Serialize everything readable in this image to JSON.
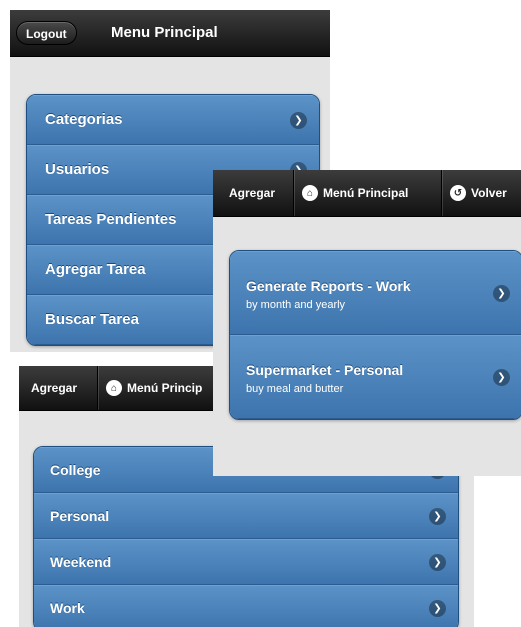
{
  "screen1": {
    "logout_label": "Logout",
    "title": "Menu Principal",
    "items": [
      {
        "label": "Categorias"
      },
      {
        "label": "Usuarios"
      },
      {
        "label": "Tareas Pendientes"
      },
      {
        "label": "Agregar Tarea"
      },
      {
        "label": "Buscar Tarea"
      }
    ]
  },
  "screen2": {
    "agregar_label": "Agregar",
    "menu_label": "Menú Principal",
    "volver_label": "Volver",
    "items": [
      {
        "title": "Generate Reports - Work",
        "subtitle": "by month and yearly"
      },
      {
        "title": "Supermarket - Personal",
        "subtitle": "buy meal and butter"
      }
    ]
  },
  "screen3": {
    "agregar_label": "Agregar",
    "menu_label": "Menú Princip",
    "items": [
      {
        "label": "College"
      },
      {
        "label": "Personal"
      },
      {
        "label": "Weekend"
      },
      {
        "label": "Work"
      }
    ]
  },
  "icons": {
    "arrow": "chevron-right-icon",
    "home": "home-icon",
    "back": "back-icon"
  },
  "colors": {
    "header": "#1a1a1a",
    "list_item": "#4a83bc",
    "background": "#e4e4e4"
  }
}
